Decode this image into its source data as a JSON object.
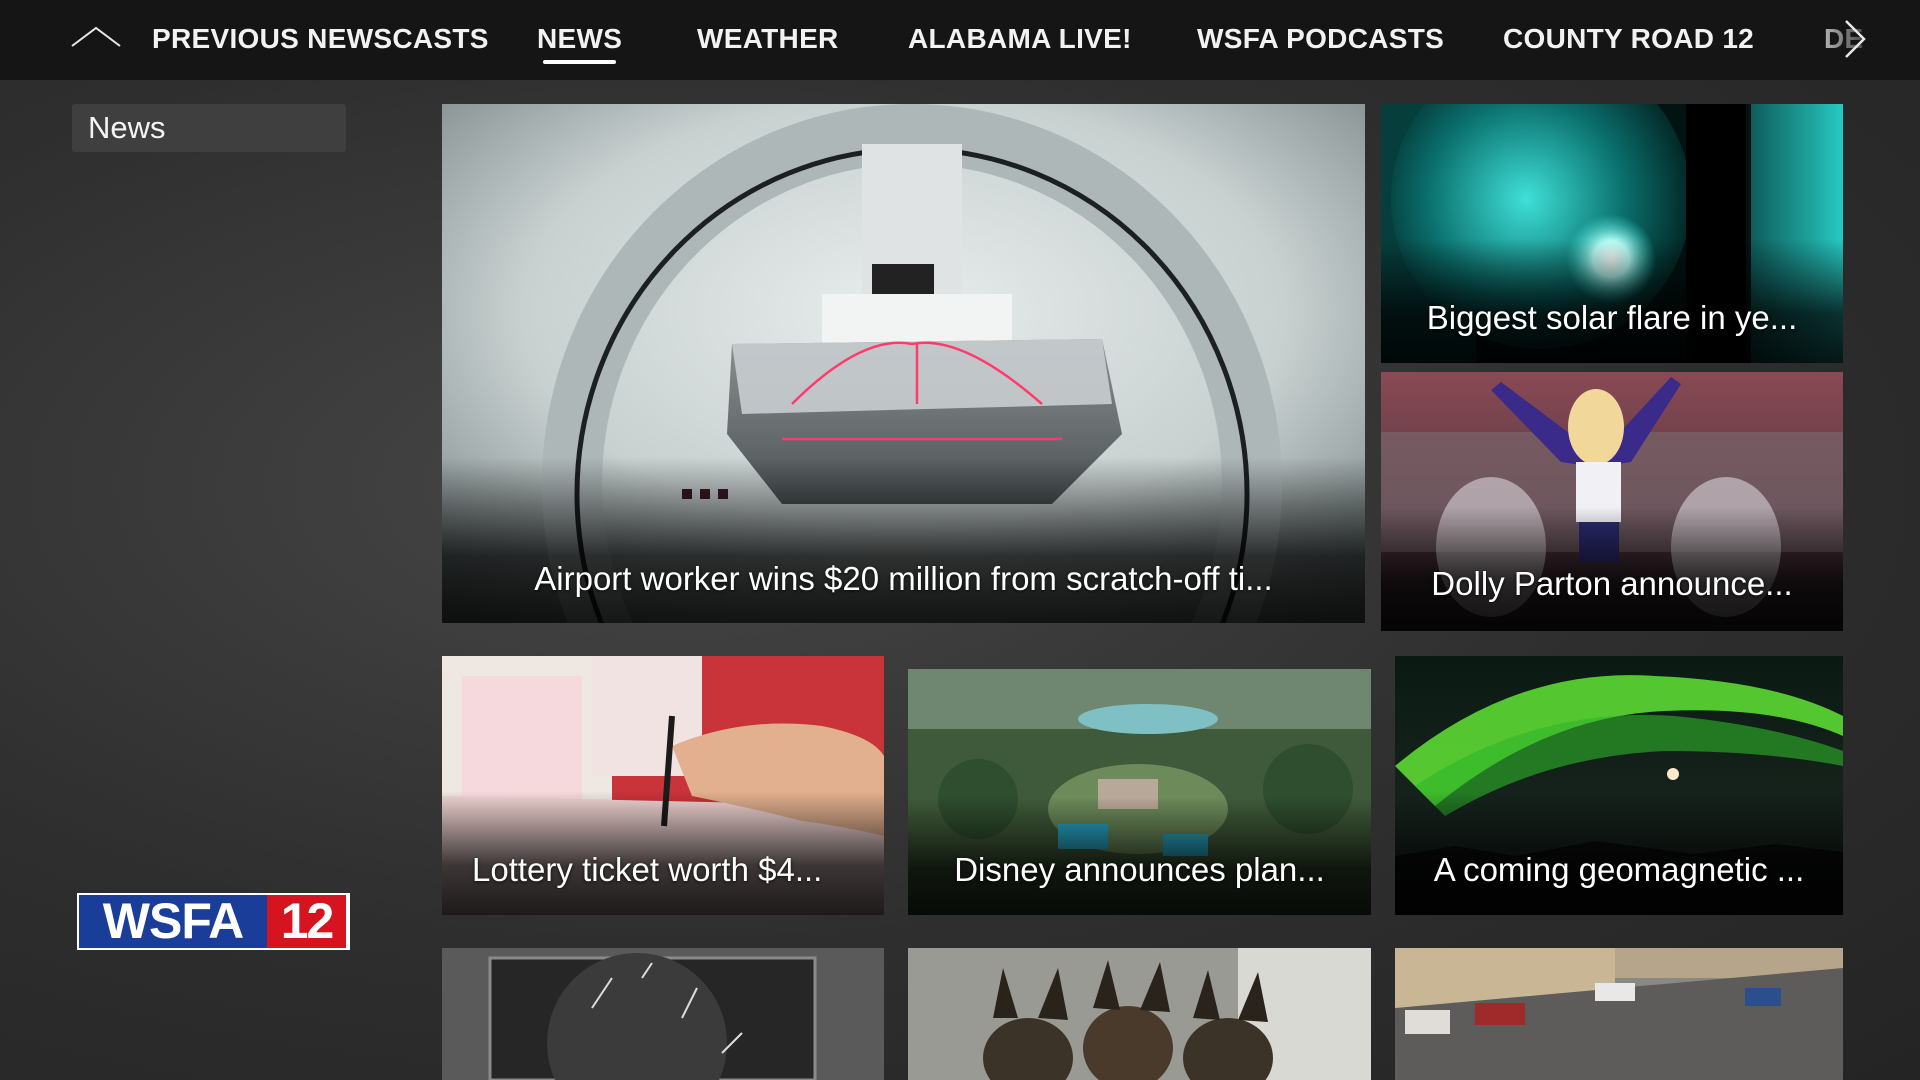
{
  "nav": {
    "items": [
      {
        "label": "PREVIOUS NEWSCASTS",
        "active": false
      },
      {
        "label": "NEWS",
        "active": true
      },
      {
        "label": "WEATHER",
        "active": false
      },
      {
        "label": "ALABAMA LIVE!",
        "active": false
      },
      {
        "label": "WSFA PODCASTS",
        "active": false
      },
      {
        "label": "COUNTY ROAD 12",
        "active": false
      },
      {
        "label": "DE",
        "active": false
      }
    ],
    "up_icon": "chevron-up-icon",
    "next_icon": "chevron-right-icon"
  },
  "sidebar": {
    "section_label": "News"
  },
  "logo": {
    "text": "WSFA",
    "number": "12",
    "colors": {
      "blue": "#1a3d99",
      "red": "#d6141f"
    }
  },
  "tiles": [
    {
      "caption": "Airport worker wins $20 million from scratch-off ti..."
    },
    {
      "caption": "Biggest solar flare in ye..."
    },
    {
      "caption": "Dolly Parton announce..."
    },
    {
      "caption": "Lottery ticket worth $4..."
    },
    {
      "caption": "Disney announces plan..."
    },
    {
      "caption": "A coming geomagnetic ..."
    },
    {
      "caption": ""
    },
    {
      "caption": ""
    },
    {
      "caption": ""
    }
  ]
}
